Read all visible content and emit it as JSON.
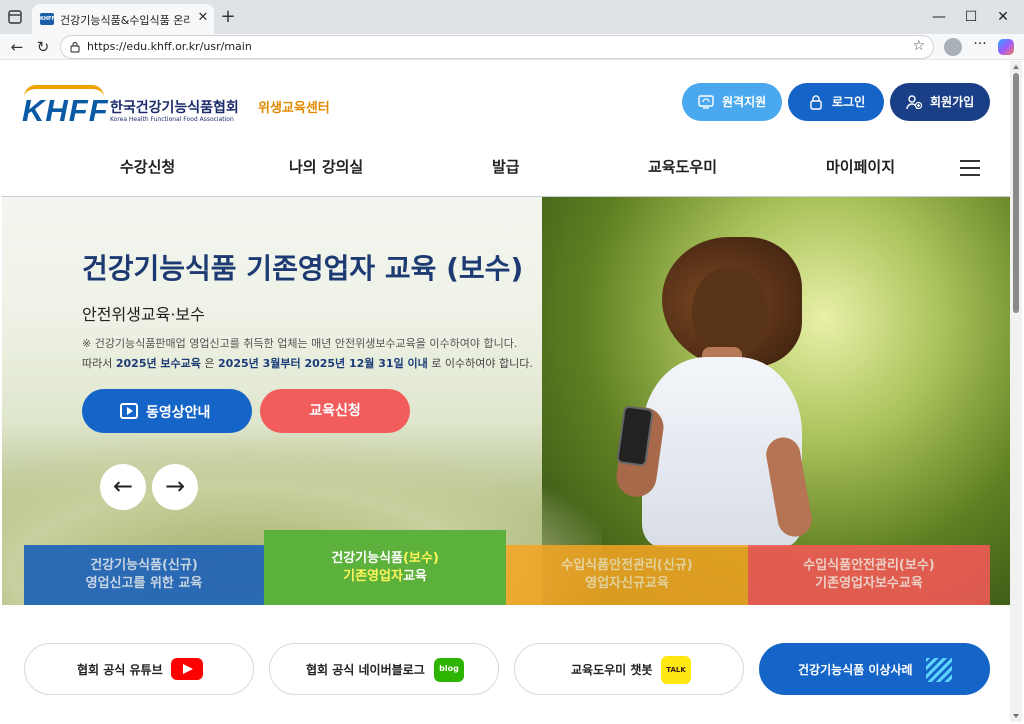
{
  "browser": {
    "tab_title": "건강기능식품&수입식품 온라인 위생교육",
    "tab_favicon_text": "KHFF",
    "url": "https://edu.khff.or.kr/usr/main",
    "icons": [
      "tab-actions-icon",
      "close-icon",
      "plus-icon",
      "minimize-icon",
      "maximize-icon",
      "window-close-icon",
      "back-arrow-icon",
      "refresh-icon",
      "lock-icon",
      "star-icon",
      "profile-icon",
      "more-icon",
      "copilot-icon"
    ],
    "glyphs": {
      "close": "✕",
      "new_tab": "+",
      "minimize": "—",
      "maximize": "☐",
      "window_close": "✕",
      "back": "←",
      "refresh": "↻",
      "star": "☆",
      "more": "···"
    }
  },
  "header": {
    "logo_text": "KHFF",
    "org_name_ko": "한국건강기능식품협회",
    "org_name_en": "Korea Health Functional Food Association",
    "center_name": "위생교육센터",
    "buttons": [
      {
        "label": "원격지원",
        "color": "#4aa8ee",
        "icon": "remote-support-icon"
      },
      {
        "label": "로그인",
        "color": "#1565c8",
        "icon": "lock-icon"
      },
      {
        "label": "회원가입",
        "color": "#1a3f86",
        "icon": "user-plus-icon"
      }
    ]
  },
  "nav": {
    "items": [
      "수강신청",
      "나의 강의실",
      "발급",
      "교육도우미",
      "마이페이지"
    ],
    "menu_icon": "hamburger-icon"
  },
  "hero": {
    "title": "건강기능식품 기존영업자 교육 (보수)",
    "subtitle": "안전위생교육·보수",
    "note1": "※ 건강기능식품판매업 영업신고를 취득한 업체는 매년 안전위생보수교육을 이수하여야 합니다.",
    "note2_prefix": "따라서 ",
    "note2_bold1": "2025년 보수교육",
    "note2_mid": " 은 ",
    "note2_bold2": "2025년 3월부터 2025년 12월 31일 이내",
    "note2_suffix": " 로 이수하여야 합니다.",
    "video_button": "동영상안내",
    "apply_button": "교육신청",
    "prev_label": "←",
    "next_label": "→"
  },
  "course_tabs": [
    {
      "line1": "건강기능식품(신규)",
      "line2": "영업신고를 위한 교육",
      "color": "#1f63b8",
      "active": false
    },
    {
      "line1_a": "건강기능식품",
      "line1_b": "(보수)",
      "line2_a": "기존영업자",
      "line2_b": "교육",
      "color": "#5bb13b",
      "highlight": "#fff45a",
      "active": true
    },
    {
      "line1": "수입식품안전관리(신규)",
      "line2": "영업자신규교육",
      "color": "#f5a623",
      "active": false
    },
    {
      "line1": "수입식품안전관리(보수)",
      "line2": "기존영업자보수교육",
      "color": "#ef5a55",
      "active": false
    }
  ],
  "quick_links": [
    {
      "label": "협회 공식 유튜브",
      "icon": "youtube-icon"
    },
    {
      "label": "협회 공식 네이버블로그",
      "icon": "blog-icon",
      "icon_text": "blog"
    },
    {
      "label": "교육도우미 챗봇",
      "icon": "kakaotalk-icon",
      "icon_text": "TALK"
    },
    {
      "label": "건강기능식품 이상사례",
      "icon": "report-icon",
      "primary": true
    }
  ]
}
